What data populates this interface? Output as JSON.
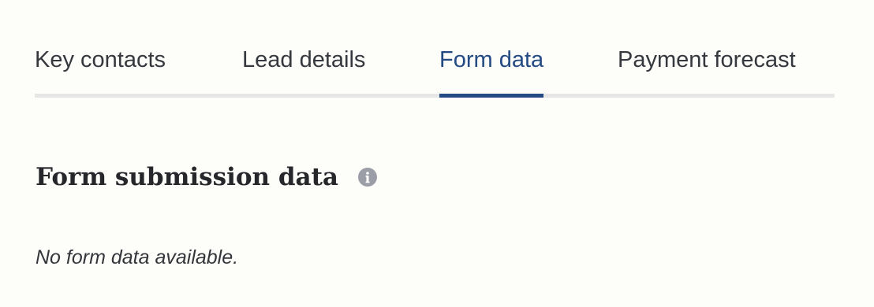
{
  "tabs": [
    {
      "label": "Key contacts",
      "active": false
    },
    {
      "label": "Lead details",
      "active": false
    },
    {
      "label": "Form data",
      "active": true
    },
    {
      "label": "Payment forecast",
      "active": false
    }
  ],
  "section": {
    "title": "Form submission data",
    "info_icon": "info-circle-icon",
    "empty_message": "No form data available."
  },
  "colors": {
    "active_tab": "#234a82",
    "tab_track": "#e6e6e6",
    "icon": "#9b9ea6",
    "background": "#fdfdfa"
  }
}
